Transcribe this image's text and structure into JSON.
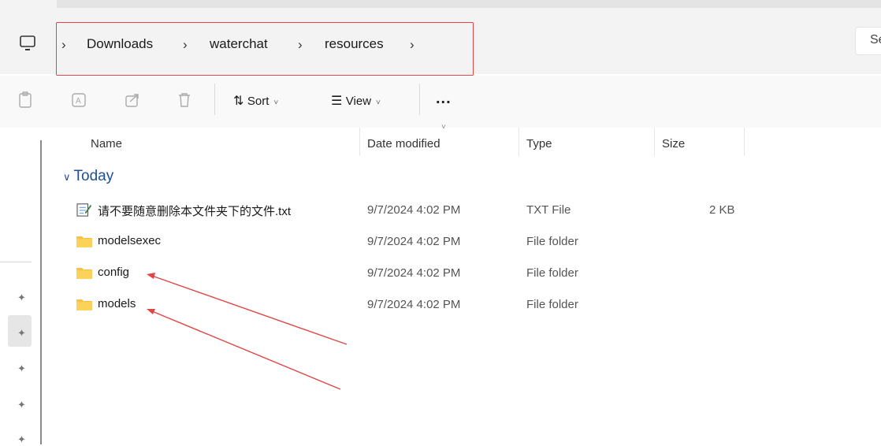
{
  "address_bar": {
    "breadcrumbs": [
      "Downloads",
      "waterchat",
      "resources"
    ],
    "search_partial": "Se"
  },
  "toolbar": {
    "sort_label": "Sort",
    "view_label": "View",
    "more_label": "..."
  },
  "columns": {
    "name": "Name",
    "date_modified": "Date modified",
    "type": "Type",
    "size": "Size"
  },
  "group": {
    "label": "Today"
  },
  "files": [
    {
      "name": "请不要随意删除本文件夹下的文件.txt",
      "date": "9/7/2024 4:02 PM",
      "type": "TXT File",
      "size": "2 KB",
      "icon": "text-file-icon"
    },
    {
      "name": "modelsexec",
      "date": "9/7/2024 4:02 PM",
      "type": "File folder",
      "size": "",
      "icon": "folder-icon"
    },
    {
      "name": "config",
      "date": "9/7/2024 4:02 PM",
      "type": "File folder",
      "size": "",
      "icon": "folder-icon"
    },
    {
      "name": "models",
      "date": "9/7/2024 4:02 PM",
      "type": "File folder",
      "size": "",
      "icon": "folder-icon"
    }
  ],
  "colors": {
    "annotation_red": "#e04646",
    "group_header_blue": "#1f4e99",
    "folder_yellow": "#f5c242"
  }
}
